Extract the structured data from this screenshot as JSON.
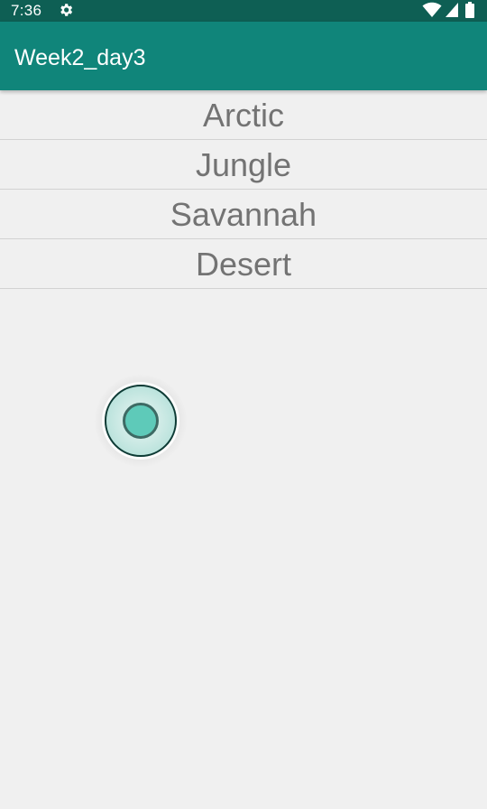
{
  "status_bar": {
    "time": "7:36",
    "icons": [
      "gear-icon",
      "wifi-icon",
      "cell-signal-icon",
      "battery-icon"
    ]
  },
  "app_bar": {
    "title": "Week2_day3"
  },
  "list": {
    "items": [
      {
        "label": "Arctic"
      },
      {
        "label": "Jungle"
      },
      {
        "label": "Savannah"
      },
      {
        "label": "Desert"
      }
    ]
  },
  "colors": {
    "status_bar": "#0e5f54",
    "app_bar": "#10857a",
    "background": "#f0f0f0",
    "list_text": "#737373",
    "touch_indicator": "#5ecab9"
  }
}
